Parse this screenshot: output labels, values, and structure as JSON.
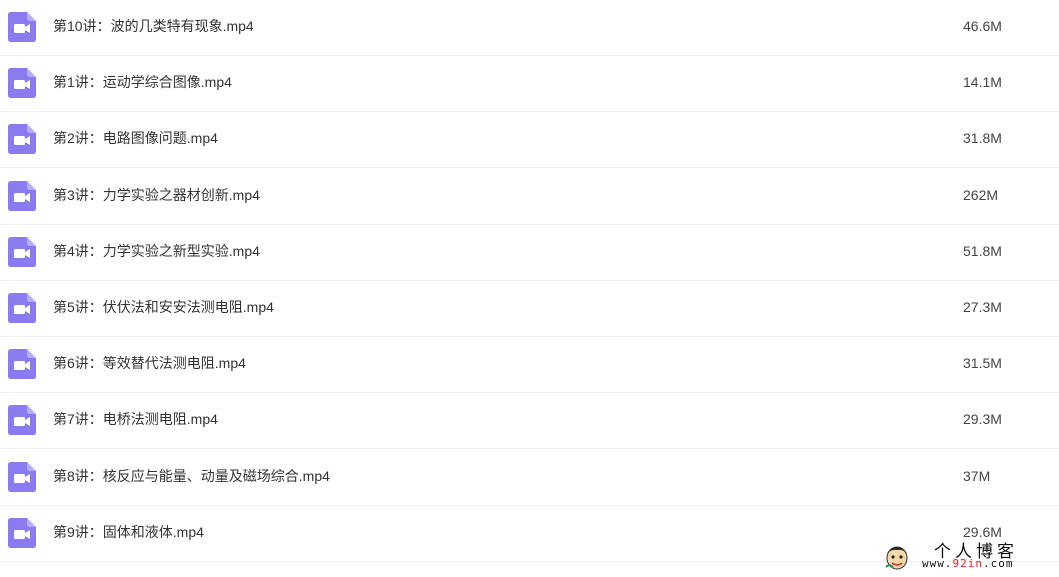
{
  "theme": {
    "icon_color": "#8a7bf0",
    "icon_fg": "#ffffff",
    "row_divider": "#f0f0f2"
  },
  "files": [
    {
      "name": "第10讲：波的几类特有现象.mp4",
      "size": "46.6M",
      "icon": "video-file-icon"
    },
    {
      "name": "第1讲：运动学综合图像.mp4",
      "size": "14.1M",
      "icon": "video-file-icon"
    },
    {
      "name": "第2讲：电路图像问题.mp4",
      "size": "31.8M",
      "icon": "video-file-icon"
    },
    {
      "name": "第3讲：力学实验之器材创新.mp4",
      "size": "262M",
      "icon": "video-file-icon"
    },
    {
      "name": "第4讲：力学实验之新型实验.mp4",
      "size": "51.8M",
      "icon": "video-file-icon"
    },
    {
      "name": "第5讲：伏伏法和安安法测电阻.mp4",
      "size": "27.3M",
      "icon": "video-file-icon"
    },
    {
      "name": "第6讲：等效替代法测电阻.mp4",
      "size": "31.5M",
      "icon": "video-file-icon"
    },
    {
      "name": "第7讲：电桥法测电阻.mp4",
      "size": "29.3M",
      "icon": "video-file-icon"
    },
    {
      "name": "第8讲：核反应与能量、动量及磁场综合.mp4",
      "size": "37M",
      "icon": "video-file-icon"
    },
    {
      "name": "第9讲：固体和液体.mp4",
      "size": "29.6M",
      "icon": "video-file-icon"
    }
  ],
  "watermark": {
    "title": "个人博客",
    "url_prefix": "www.",
    "url_accent": "92in",
    "url_suffix": ".com"
  }
}
